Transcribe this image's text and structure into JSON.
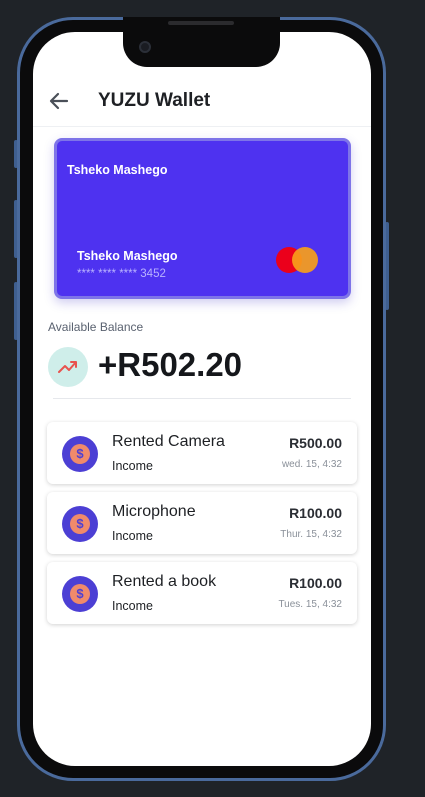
{
  "header": {
    "title": "YUZU Wallet",
    "back_icon": "arrow-left-icon"
  },
  "card": {
    "holder_top": "Tsheko Mashego",
    "holder": "Tsheko Mashego",
    "number": "**** **** **** 3452",
    "brand_icon": "mastercard-icon",
    "color": "#4e32f0"
  },
  "balance": {
    "label": "Available Balance",
    "amount": "+R502.20",
    "icon": "trending-up-icon"
  },
  "transactions": [
    {
      "name": "Rented Camera",
      "type": "Income",
      "amount": "R500.00",
      "date": "wed. 15, 4:32",
      "icon": "dollar-icon"
    },
    {
      "name": "Microphone",
      "type": "Income",
      "amount": "R100.00",
      "date": "Thur. 15, 4:32",
      "icon": "dollar-icon"
    },
    {
      "name": "Rented a book",
      "type": "Income",
      "amount": "R100.00",
      "date": "Tues. 15, 4:32",
      "icon": "dollar-icon"
    }
  ]
}
